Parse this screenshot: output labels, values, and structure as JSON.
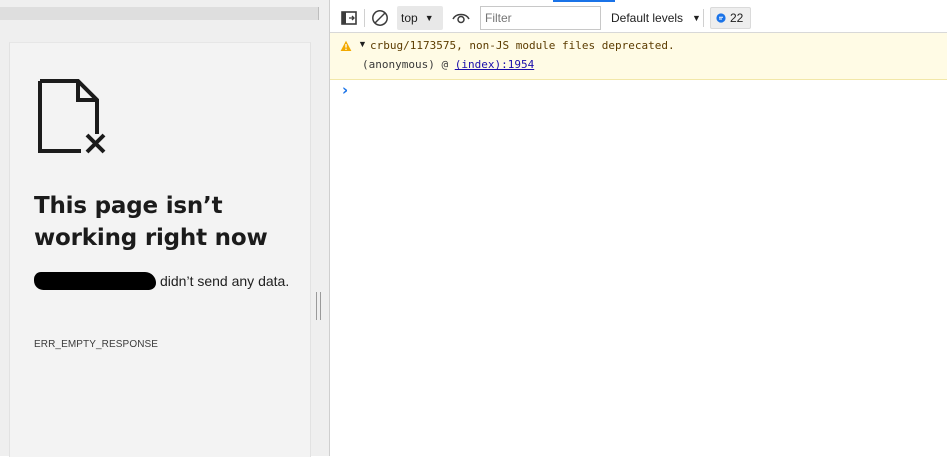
{
  "page": {
    "error_title": "This page isn’t working right now",
    "error_desc_suffix": "didn’t send any data.",
    "error_code": "ERR_EMPTY_RESPONSE"
  },
  "devtools": {
    "context": "top",
    "filter_placeholder": "Filter",
    "levels": "Default levels",
    "issues_count": "22",
    "warning_message": "crbug/1173575, non-JS module files deprecated.",
    "stack_function": "(anonymous)",
    "stack_at": "@",
    "stack_link": "(index):1954",
    "prompt_symbol": "›"
  },
  "colors": {
    "accent": "#1a73e8",
    "warning_bg": "#fffbe5",
    "warning_icon": "#f2a900",
    "page_bg": "#f3f3f3"
  },
  "icons": [
    "dock-side-icon",
    "clear-console-icon",
    "eye-icon",
    "warning-icon",
    "issues-icon",
    "file-error-icon"
  ]
}
